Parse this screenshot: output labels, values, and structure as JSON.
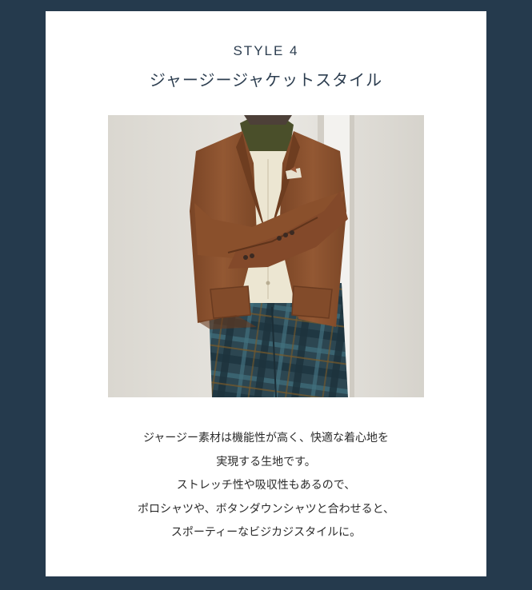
{
  "section": {
    "label": "STYLE 4",
    "title": "ジャージージャケットスタイル"
  },
  "photo": {
    "subject": "man-in-brown-jersey-jacket-with-plaid-trousers"
  },
  "description": {
    "lines": [
      "ジャージー素材は機能性が高く、快適な着心地を",
      "実現する生地です。",
      "ストレッチ性や吸収性もあるので、",
      "ポロシャツや、ボタンダウンシャツと合わせると、",
      "スポーティーなビジカジスタイルに。"
    ]
  },
  "colors": {
    "frame": "#253a4d",
    "card": "#ffffff",
    "heading": "#2d3e50",
    "body_text": "#2b2b2b",
    "jacket": "#8a4f2c",
    "vest": "#ece6d2",
    "shirt": "#4a4f2a",
    "trousers": "#2d4a55"
  }
}
